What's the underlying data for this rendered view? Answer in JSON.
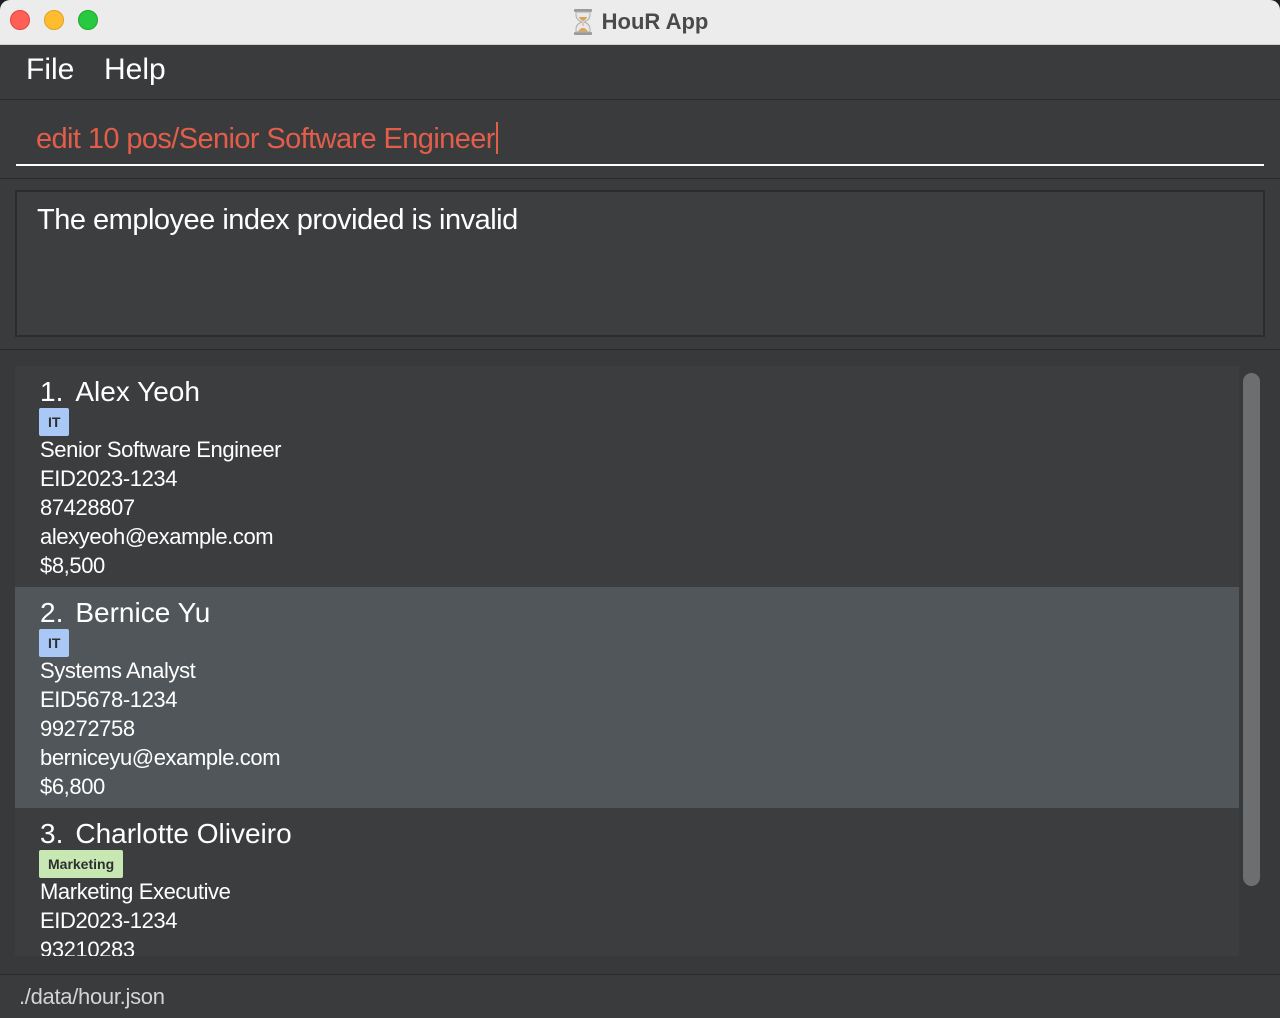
{
  "window": {
    "title": "HouR App",
    "app_icon": "hourglass-icon"
  },
  "menu": {
    "items": [
      {
        "label": "File"
      },
      {
        "label": "Help"
      }
    ]
  },
  "command": {
    "value": "edit 10 pos/Senior Software Engineer",
    "text_color": "#e25d4a"
  },
  "result": {
    "message": "The employee index provided is invalid"
  },
  "employees": [
    {
      "index": "1.",
      "name": "Alex Yeoh",
      "tag": "IT",
      "position": "Senior Software Engineer",
      "eid": "EID2023-1234",
      "phone": "87428807",
      "email": "alexyeoh@example.com",
      "salary": "$8,500",
      "selected": false
    },
    {
      "index": "2.",
      "name": "Bernice Yu",
      "tag": "IT",
      "position": "Systems Analyst",
      "eid": "EID5678-1234",
      "phone": "99272758",
      "email": "berniceyu@example.com",
      "salary": "$6,800",
      "selected": true
    },
    {
      "index": "3.",
      "name": "Charlotte Oliveiro",
      "tag": "Marketing",
      "position": "Marketing Executive",
      "eid": "EID2023-1234",
      "phone": "93210283"
    }
  ],
  "status": {
    "file_path": "./data/hour.json"
  },
  "colors": {
    "tag_it": "#a9c8f5",
    "tag_marketing": "#c7e8b3",
    "selected_row": "#50565a",
    "background": "#3c3d3f"
  }
}
